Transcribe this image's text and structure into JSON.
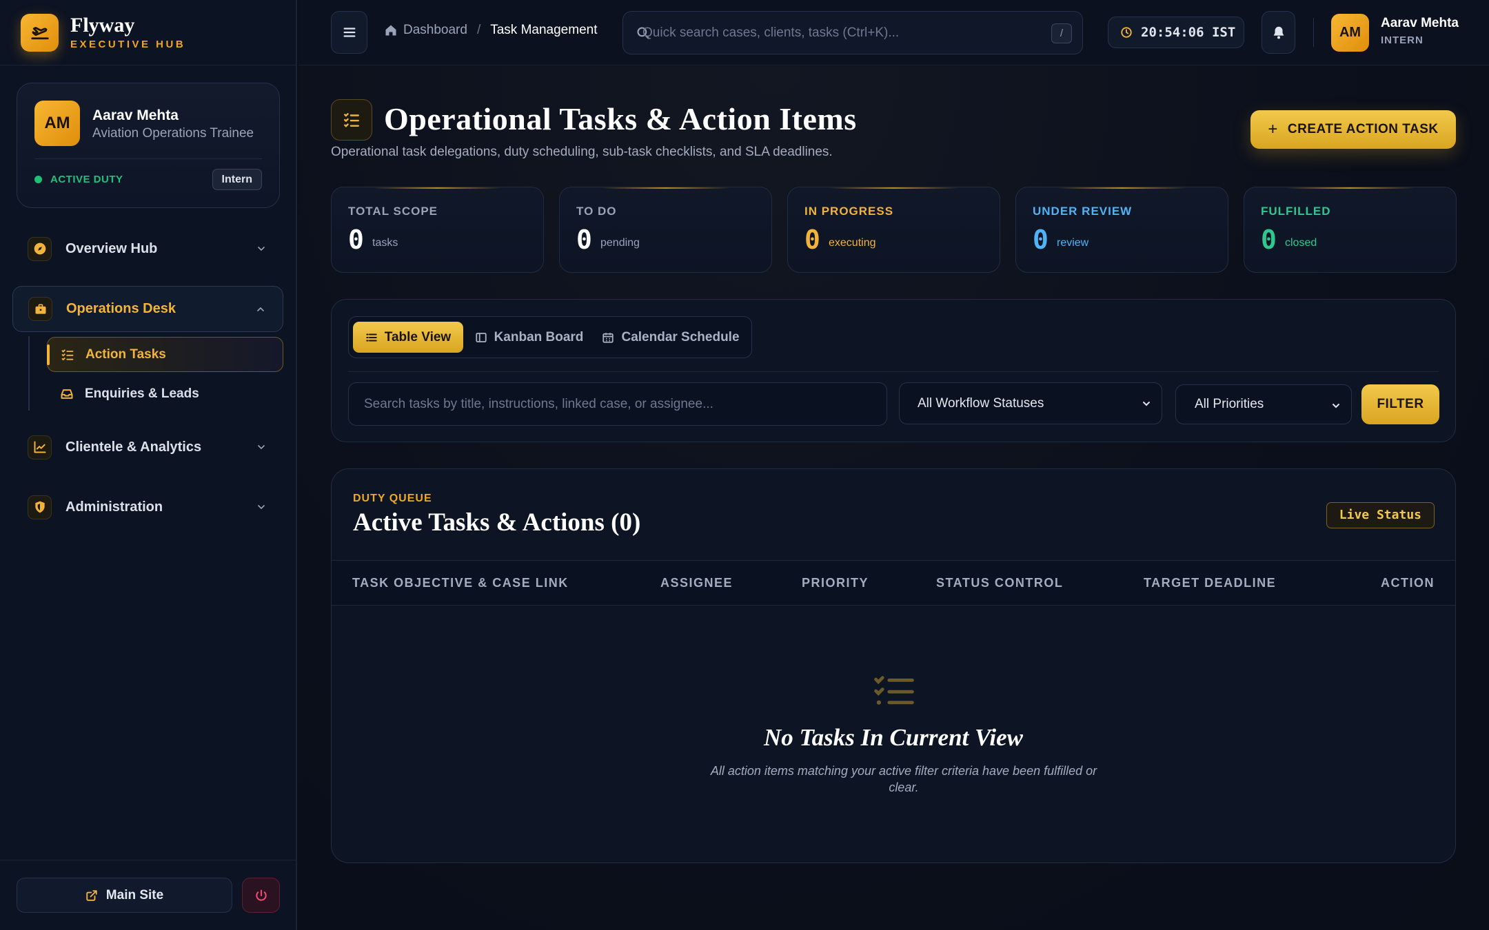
{
  "brand": {
    "name": "Flyway",
    "subtitle": "EXECUTIVE HUB"
  },
  "profile": {
    "initials": "AM",
    "name": "Aarav Mehta",
    "role": "Aviation Operations Trainee",
    "status": "ACTIVE DUTY",
    "badge": "Intern"
  },
  "sidebar": {
    "items": [
      {
        "label": "Overview Hub",
        "icon": "compass-icon"
      },
      {
        "label": "Operations Desk",
        "icon": "briefcase-icon",
        "expanded": true,
        "children": [
          {
            "label": "Action Tasks",
            "icon": "checklist-icon",
            "active": true
          },
          {
            "label": "Enquiries & Leads",
            "icon": "inbox-icon"
          }
        ]
      },
      {
        "label": "Clientele & Analytics",
        "icon": "chart-line-icon"
      },
      {
        "label": "Administration",
        "icon": "shield-icon"
      }
    ],
    "footer": {
      "main_site": "Main Site",
      "power": "power-icon"
    }
  },
  "header": {
    "breadcrumb": {
      "home": "Dashboard",
      "separator": "/",
      "current": "Task Management"
    },
    "search_placeholder": "Quick search cases, clients, tasks (Ctrl+K)...",
    "search_shortcut": "/",
    "clock": "20:54:06 IST",
    "user": {
      "initials": "AM",
      "name": "Aarav Mehta",
      "role": "INTERN"
    }
  },
  "page": {
    "title": "Operational Tasks & Action Items",
    "subtitle": "Operational task delegations, duty scheduling, sub-task checklists, and SLA deadlines.",
    "create_button": "CREATE ACTION TASK"
  },
  "stats": [
    {
      "label": "TOTAL SCOPE",
      "value": "0",
      "unit": "tasks",
      "color": "#9aa4b8",
      "value_color": "#ffffff"
    },
    {
      "label": "TO DO",
      "value": "0",
      "unit": "pending",
      "color": "#9aa4b8",
      "value_color": "#ffffff"
    },
    {
      "label": "IN PROGRESS",
      "value": "0",
      "unit": "executing",
      "color": "#f2b33d",
      "value_color": "#f2b33d"
    },
    {
      "label": "UNDER REVIEW",
      "value": "0",
      "unit": "review",
      "color": "#4fb3f6",
      "value_color": "#4fb3f6"
    },
    {
      "label": "FULFILLED",
      "value": "0",
      "unit": "closed",
      "color": "#2ec88e",
      "value_color": "#2ec88e"
    }
  ],
  "views": {
    "table": "Table View",
    "kanban": "Kanban Board",
    "calendar": "Calendar Schedule"
  },
  "filters": {
    "search_placeholder": "Search tasks by title, instructions, linked case, or assignee...",
    "status_selected": "All Workflow Statuses",
    "priority_selected": "All Priorities",
    "filter_button": "FILTER"
  },
  "queue": {
    "eyebrow": "DUTY QUEUE",
    "title": "Active Tasks & Actions (0)",
    "live": "Live Status",
    "columns": [
      "TASK OBJECTIVE & CASE LINK",
      "ASSIGNEE",
      "PRIORITY",
      "STATUS CONTROL",
      "TARGET DEADLINE",
      "ACTION"
    ],
    "empty_title": "No Tasks In Current View",
    "empty_desc": "All action items matching your active filter criteria have been fulfilled or clear."
  },
  "colors": {
    "accent": "#f2b33d",
    "bg": "#0a0f1c"
  }
}
